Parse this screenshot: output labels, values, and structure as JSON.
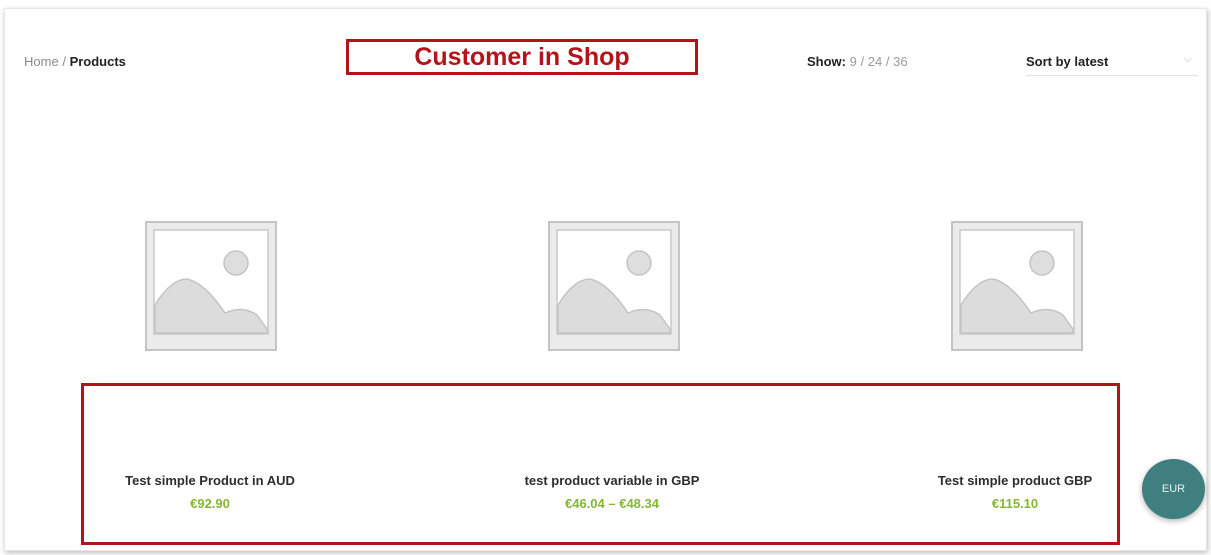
{
  "breadcrumb": {
    "home": "Home",
    "separator": "/",
    "current": "Products"
  },
  "annotation": {
    "title": "Customer in Shop"
  },
  "show": {
    "label": "Show",
    "colon": ":",
    "options": [
      "9",
      "24",
      "36"
    ],
    "separator": "/"
  },
  "sort": {
    "label": "Sort by latest",
    "chevron": "⌵"
  },
  "products": [
    {
      "name": "Test simple Product in AUD",
      "price": "€92.90",
      "image": "placeholder-image-icon"
    },
    {
      "name": "test product variable in GBP",
      "price": "€46.04 – €48.34",
      "image": "placeholder-image-icon"
    },
    {
      "name": "Test simple product GBP",
      "price": "€115.10",
      "image": "placeholder-image-icon"
    }
  ],
  "currency_switcher": {
    "label": "EUR"
  },
  "colors": {
    "accent": "#b3141c",
    "price": "#83b735",
    "currency_button": "#3f7f7f"
  }
}
